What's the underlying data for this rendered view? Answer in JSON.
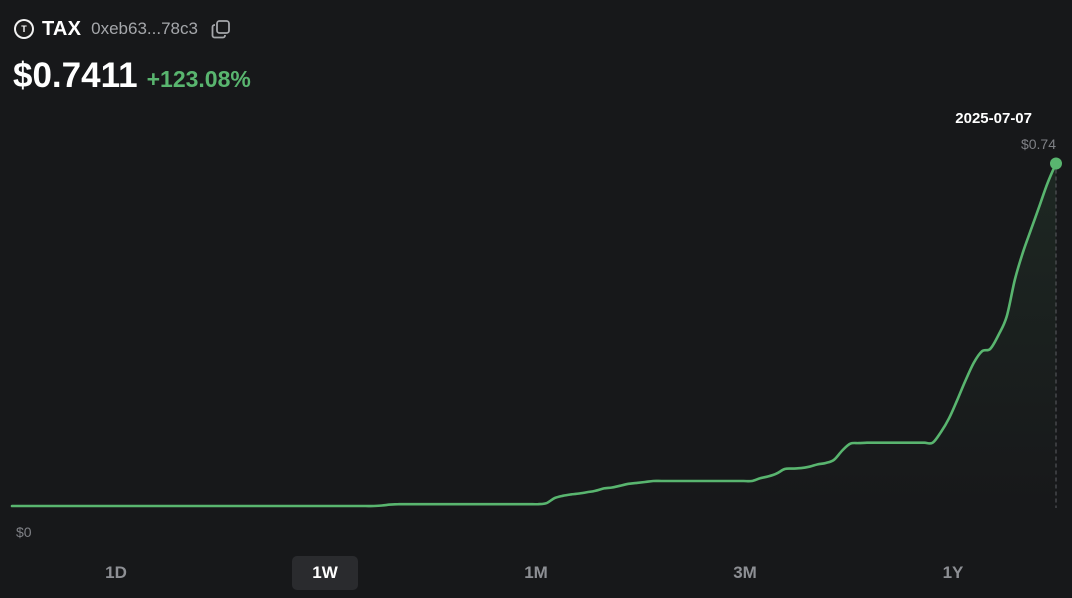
{
  "token": {
    "logo_letter": "T",
    "symbol": "TAX",
    "address": "0xeb63...78c3",
    "price": "$0.7411",
    "change": "+123.08%"
  },
  "colors": {
    "background": "#17181a",
    "line": "#59b56f",
    "text_muted": "#8d8f94"
  },
  "icons": {
    "copy": "copy-icon",
    "logo": "token-logo-icon"
  },
  "range_tabs": [
    {
      "label": "1D",
      "active": false
    },
    {
      "label": "1W",
      "active": true
    },
    {
      "label": "1M",
      "active": false
    },
    {
      "label": "3M",
      "active": false
    },
    {
      "label": "1Y",
      "active": false
    }
  ],
  "chart_data": {
    "type": "line",
    "y_min_label": "$0",
    "ylim": [
      0,
      0.74
    ],
    "grid": false,
    "series": [
      {
        "values": [
          0,
          0,
          0,
          0,
          0,
          0,
          0,
          0,
          0,
          0,
          0,
          0,
          0,
          0,
          0,
          0,
          0,
          0,
          0,
          0,
          0,
          0,
          0,
          0,
          0,
          0,
          0,
          0,
          0,
          0,
          0,
          0,
          0,
          0,
          0,
          0,
          0,
          0,
          0,
          0,
          0,
          0,
          0,
          0,
          0,
          0.001,
          0.003,
          0.004,
          0.004,
          0.004,
          0.004,
          0.004,
          0.004,
          0.004,
          0.004,
          0.004,
          0.004,
          0.004,
          0.004,
          0.004,
          0.004,
          0.004,
          0.004,
          0.004,
          0.004,
          0.006,
          0.017,
          0.022,
          0.025,
          0.027,
          0.03,
          0.033,
          0.038,
          0.04,
          0.044,
          0.048,
          0.05,
          0.052,
          0.054,
          0.054,
          0.054,
          0.054,
          0.054,
          0.054,
          0.054,
          0.054,
          0.054,
          0.054,
          0.054,
          0.054,
          0.054,
          0.06,
          0.064,
          0.07,
          0.08,
          0.081,
          0.082,
          0.085,
          0.09,
          0.093,
          0.1,
          0.12,
          0.135,
          0.136,
          0.137,
          0.137,
          0.137,
          0.137,
          0.137,
          0.137,
          0.137,
          0.137,
          0.137,
          0.16,
          0.19,
          0.23,
          0.272,
          0.31,
          0.335,
          0.34,
          0.37,
          0.41,
          0.49,
          0.55,
          0.6,
          0.65,
          0.7,
          0.741
        ]
      }
    ],
    "last_point": {
      "date": "2025-07-07",
      "value": "$0.74"
    }
  }
}
